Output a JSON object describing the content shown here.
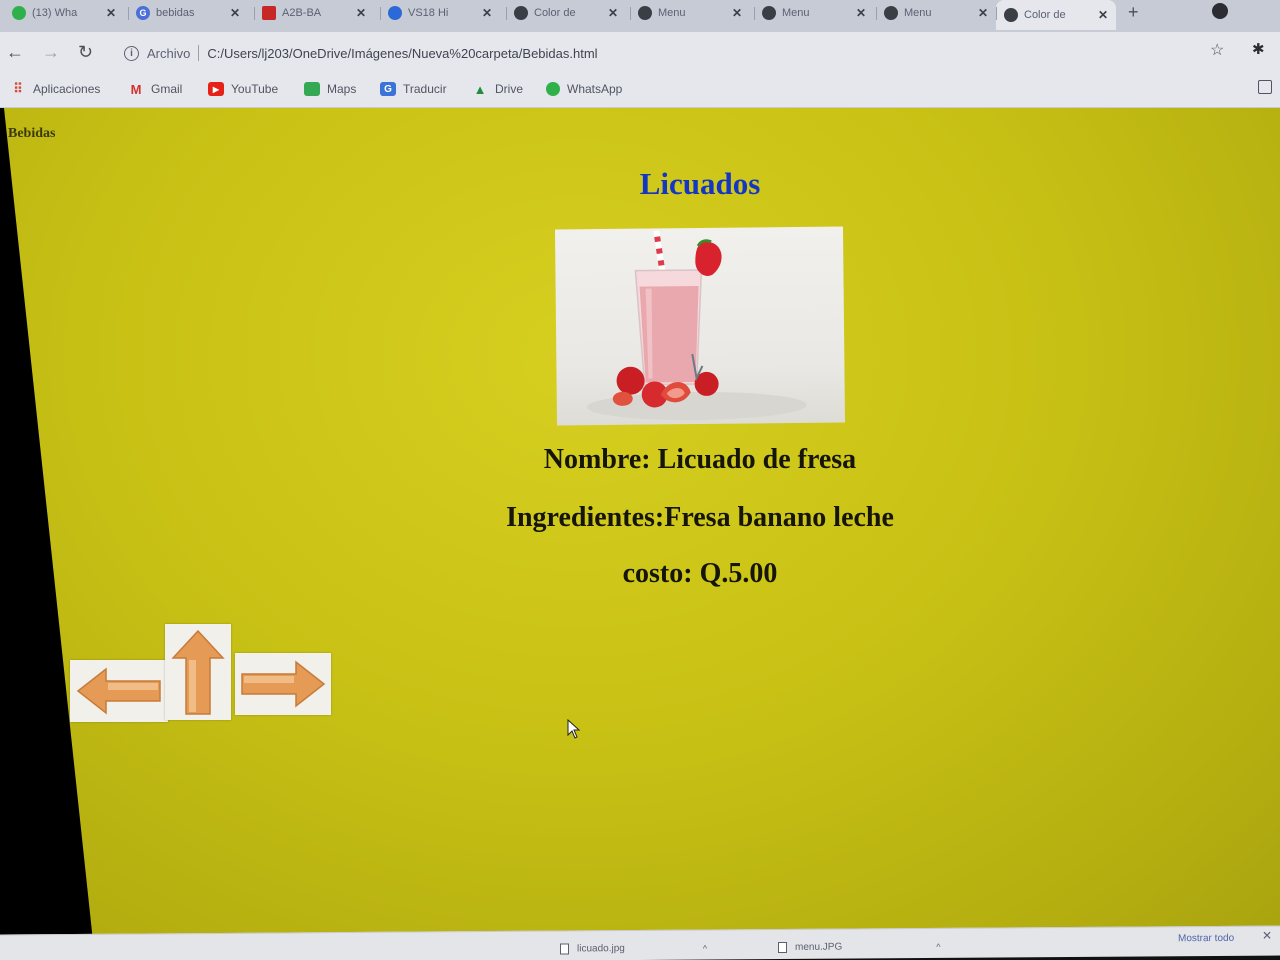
{
  "browser": {
    "tabs": [
      {
        "label": "(13) Wha",
        "icon": "whatsapp-icon",
        "color": "#2fb04a",
        "active": false
      },
      {
        "label": "bebidas",
        "icon": "google-icon",
        "color": "#4a6fd8",
        "active": false
      },
      {
        "label": "A2B-BA",
        "icon": "pdf-icon",
        "color": "#c62828",
        "active": false
      },
      {
        "label": "VS18 Hi",
        "icon": "drive-icon",
        "color": "#2b6ad6",
        "active": false
      },
      {
        "label": "Color de",
        "icon": "globe-icon",
        "color": "#3a3e45",
        "active": false
      },
      {
        "label": "Menu",
        "icon": "globe-icon",
        "color": "#3a3e45",
        "active": false
      },
      {
        "label": "Menu",
        "icon": "globe-icon",
        "color": "#3a3e45",
        "active": false
      },
      {
        "label": "Menu",
        "icon": "globe-icon",
        "color": "#3a3e45",
        "active": false
      },
      {
        "label": "Color de",
        "icon": "globe-icon",
        "color": "#3a3e45",
        "active": true
      }
    ],
    "address": {
      "scheme_label": "Archivo",
      "url": "C:/Users/lj203/OneDrive/Imágenes/Nueva%20carpeta/Bebidas.html"
    },
    "bookmarks": [
      {
        "label": "Aplicaciones",
        "icon": "apps-grid-icon",
        "color": "#d64a3a"
      },
      {
        "label": "Gmail",
        "icon": "gmail-icon",
        "color": "#d3322b"
      },
      {
        "label": "YouTube",
        "icon": "youtube-icon",
        "color": "#e62117"
      },
      {
        "label": "Maps",
        "icon": "maps-icon",
        "color": "#34a853"
      },
      {
        "label": "Traducir",
        "icon": "translate-icon",
        "color": "#3b73d9"
      },
      {
        "label": "Drive",
        "icon": "drive-icon",
        "color": "#1e8e3e"
      },
      {
        "label": "WhatsApp",
        "icon": "whatsapp-icon",
        "color": "#2fb04a"
      }
    ]
  },
  "page": {
    "corner_label": "Bebidas",
    "title": "Licuados",
    "title_color": "#1336c4",
    "background_color": "#c9c215",
    "nombre": "Nombre: Licuado de fresa",
    "ingredientes": "Ingredientes:Fresa banano leche",
    "costo": "costo: Q.5.00",
    "nav_arrows": [
      "arrow-left-icon",
      "arrow-up-icon",
      "arrow-right-icon"
    ],
    "arrow_color": "#e59a55"
  },
  "downloads": {
    "items": [
      "licuado.jpg",
      "menu.JPG"
    ],
    "show_all": "Mostrar todo"
  }
}
